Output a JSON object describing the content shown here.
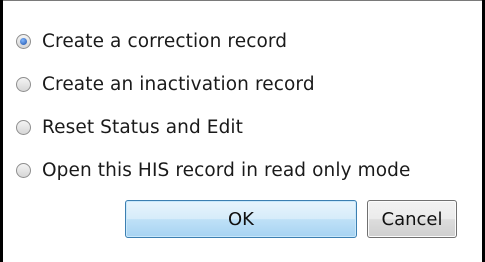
{
  "options": [
    {
      "label": "Create a correction record",
      "checked": true
    },
    {
      "label": "Create an inactivation record",
      "checked": false
    },
    {
      "label": "Reset Status and Edit",
      "checked": false
    },
    {
      "label": "Open this HIS record in read only mode",
      "checked": false
    }
  ],
  "buttons": {
    "ok_label": "OK",
    "cancel_label": "Cancel"
  },
  "colors": {
    "accent": "#3c7fb1",
    "selected_dot": "#1e4fa6"
  }
}
